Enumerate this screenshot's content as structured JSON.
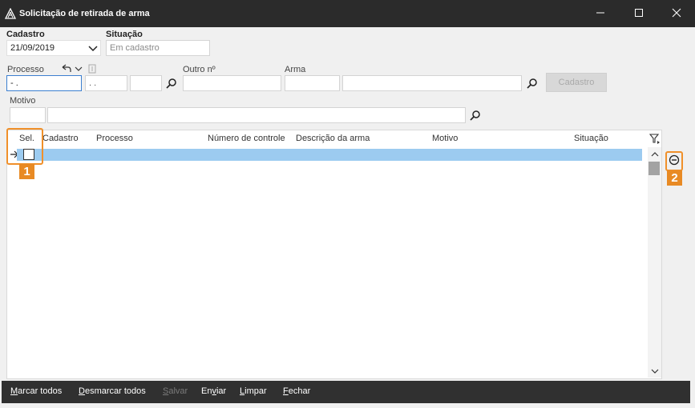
{
  "window": {
    "title": "Solicitação de retirada de arma",
    "app_icon": "triangle-app-icon",
    "minimize_icon": "minimize-icon",
    "maximize_icon": "maximize-icon",
    "close_icon": "close-icon"
  },
  "form": {
    "cadastro_label": "Cadastro",
    "cadastro_value": "21/09/2019",
    "situacao_label": "Situação",
    "situacao_placeholder": "Em cadastro",
    "processo_label": "Processo",
    "processo_value": "  -  .",
    "processo_part2_value": ". .",
    "processo_part3_value": "",
    "outro_label": "Outro nº",
    "outro_value": "",
    "arma_label": "Arma",
    "arma_code_value": "",
    "arma_desc_value": "",
    "cadastro_button_label": "Cadastro",
    "motivo_label": "Motivo",
    "motivo_code_value": "",
    "motivo_desc_value": ""
  },
  "grid": {
    "columns": [
      "Sel.",
      "Cadastro",
      "Processo",
      "Número de controle",
      "Descrição da arma",
      "Motivo",
      "Situação"
    ],
    "rows": [
      {
        "selected": false,
        "current": true
      }
    ]
  },
  "footer": {
    "buttons": [
      {
        "label": "Marcar todos",
        "mnemonic": "M",
        "rest": "arcar todos",
        "enabled": true
      },
      {
        "label": "Desmarcar todos",
        "mnemonic": "D",
        "rest": "esmarcar todos",
        "enabled": true
      },
      {
        "label": "Salvar",
        "mnemonic": "S",
        "rest": "alvar",
        "enabled": false
      },
      {
        "label": "Enviar",
        "pre": "En",
        "mnemonic": "v",
        "rest": "iar",
        "enabled": true
      },
      {
        "label": "Limpar",
        "mnemonic": "L",
        "rest": "impar",
        "enabled": true
      },
      {
        "label": "Fechar",
        "mnemonic": "F",
        "rest": "echar",
        "enabled": true
      }
    ]
  },
  "callouts": [
    {
      "number": "1"
    },
    {
      "number": "2"
    }
  ],
  "colors": {
    "titlebar": "#2b2b2b",
    "selected_row": "#9ccbf0",
    "callout": "#e88a24",
    "footer": "#303030"
  }
}
